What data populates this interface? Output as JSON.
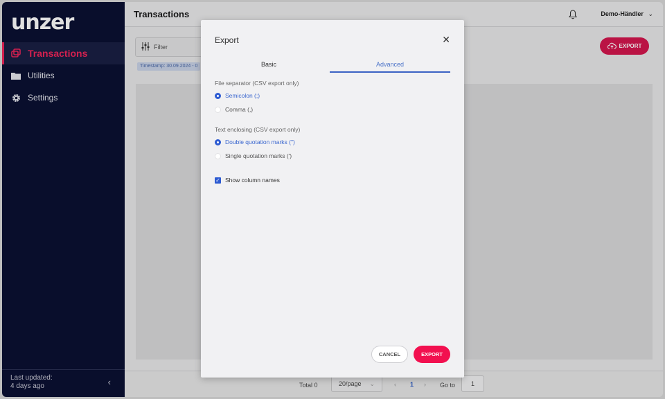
{
  "sidebar": {
    "logo": "unzer",
    "items": [
      {
        "label": "Transactions",
        "icon": "transactions-icon"
      },
      {
        "label": "Utilities",
        "icon": "folder-icon"
      },
      {
        "label": "Settings",
        "icon": "gear-icon"
      }
    ],
    "footer": {
      "line1": "Last updated:",
      "line2": "4 days ago"
    }
  },
  "header": {
    "title": "Transactions",
    "user": "Demo-Händler"
  },
  "toolbar": {
    "filter_label": "Filter",
    "timestamp_chip": "Timestamp: 30.09.2024 - 0",
    "export_label": "EXPORT"
  },
  "pager": {
    "total": "Total 0",
    "page_size": "20/page",
    "current_page": "1",
    "goto_label": "Go to",
    "goto_value": "1"
  },
  "modal": {
    "title": "Export",
    "tabs": [
      {
        "label": "Basic",
        "active": false
      },
      {
        "label": "Advanced",
        "active": true
      }
    ],
    "separator": {
      "label": "File separator (CSV export only)",
      "options": [
        {
          "label": "Semicolon (;)",
          "selected": true
        },
        {
          "label": "Comma (,)",
          "selected": false
        }
      ]
    },
    "enclosing": {
      "label": "Text enclosing (CSV export only)",
      "options": [
        {
          "label": "Double quotation marks (\")",
          "selected": true
        },
        {
          "label": "Single quotation marks (')",
          "selected": false
        }
      ]
    },
    "show_column_names": {
      "label": "Show column names",
      "checked": true
    },
    "cancel_label": "CANCEL",
    "export_label": "EXPORT"
  },
  "colors": {
    "brand": "#f2104f",
    "sidebar_bg": "#0b1033",
    "accent_blue": "#2d5bd2"
  }
}
